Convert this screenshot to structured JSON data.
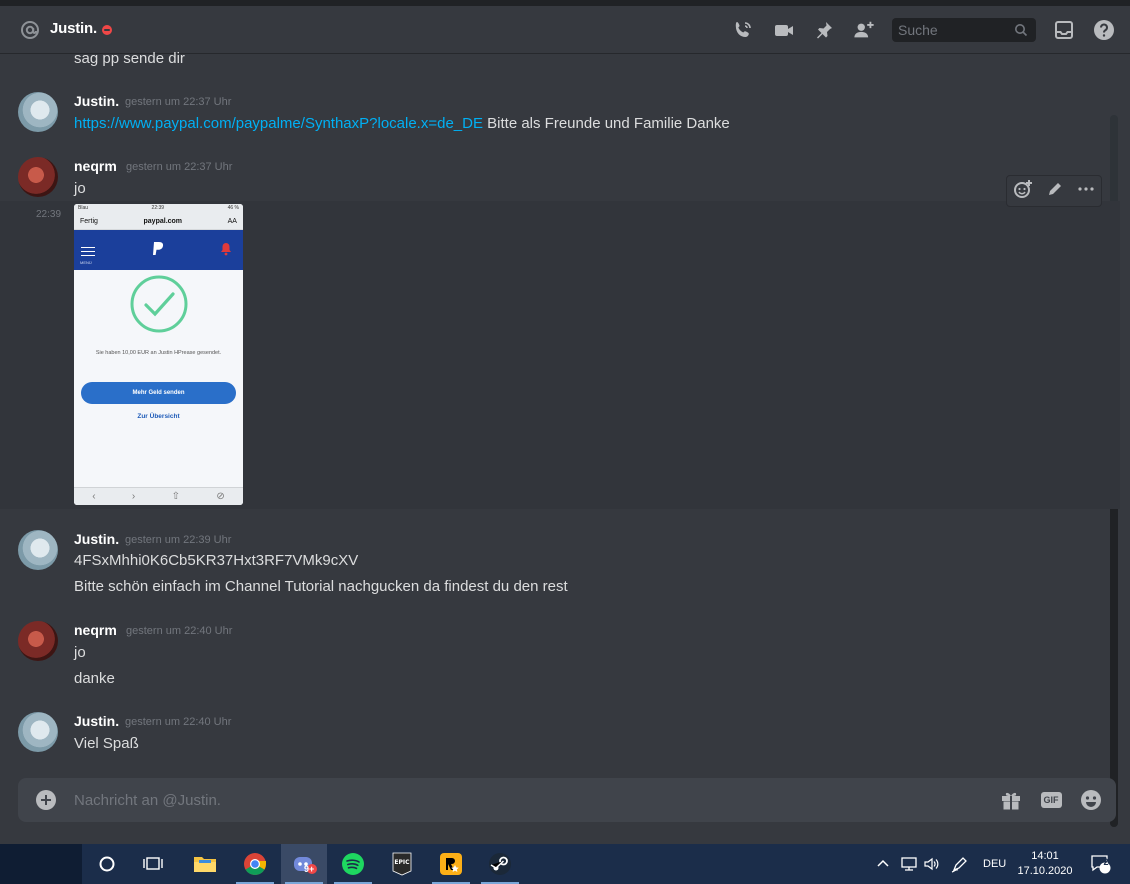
{
  "header": {
    "username": "Justin.",
    "search_placeholder": "Suche"
  },
  "messages": [
    {
      "type": "continuation",
      "text": "sag pp sende dir"
    },
    {
      "type": "group",
      "author": "Justin.",
      "timestamp": "gestern um 22:37 Uhr",
      "link": "https://www.paypal.com/paypalme/SynthaxP?locale.x=de_DE",
      "text": " Bitte als Freunde und Familie Danke"
    },
    {
      "type": "group",
      "author": "neqrm",
      "timestamp": "gestern um 22:37 Uhr",
      "lines": [
        "jo"
      ]
    },
    {
      "type": "attachment",
      "side_timestamp": "22:39"
    },
    {
      "type": "group",
      "author": "Justin.",
      "timestamp": "gestern um 22:39 Uhr",
      "lines": [
        "4FSxMhhi0K6Cb5KR37Hxt3RF7VMk9cXV",
        "Bitte schön einfach im Channel Tutorial nachgucken da findest du den rest"
      ]
    },
    {
      "type": "group",
      "author": "neqrm",
      "timestamp": "gestern um 22:40 Uhr",
      "lines": [
        "jo",
        "danke"
      ]
    },
    {
      "type": "group",
      "author": "Justin.",
      "timestamp": "gestern um 22:40 Uhr",
      "lines": [
        "Viel Spaß"
      ]
    }
  ],
  "attachment": {
    "status_left": "Blau",
    "status_time": "22:39",
    "status_right": "46 %",
    "done_label": "Fertig",
    "url": "paypal.com",
    "text_size_label": "AA",
    "menu_label": "MENÜ",
    "notification_count": "1",
    "sent_text": "Sie haben 10,00 EUR an Justin HPrease gesendet.",
    "send_more_label": "Mehr Geld senden",
    "overview_label": "Zur Übersicht"
  },
  "composer": {
    "placeholder": "Nachricht an @Justin."
  },
  "taskbar": {
    "discord_badge": "9+",
    "language": "DEU",
    "time": "14:01",
    "date": "17.10.2020",
    "notification_count": "2",
    "epic_label": "EPIC"
  },
  "colors": {
    "background": "#36393f",
    "link": "#00b0f4",
    "dnd": "#f04747",
    "taskbar": "#1b2d4a"
  }
}
